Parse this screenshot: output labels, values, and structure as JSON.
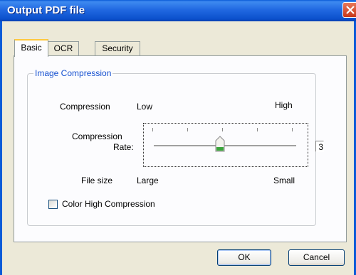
{
  "window": {
    "title": "Output PDF file"
  },
  "tabs": [
    {
      "label": "Basic",
      "active": true
    },
    {
      "label": "OCR",
      "active": false
    },
    {
      "label": "Security",
      "active": false
    }
  ],
  "group": {
    "title": "Image Compression",
    "compression_label": "Compression",
    "compression_low": "Low",
    "compression_high": "High",
    "rate_label_line1": "Compression",
    "rate_label_line2": "Rate:",
    "rate_value": "3",
    "filesize_label": "File size",
    "filesize_large": "Large",
    "filesize_small": "Small",
    "checkbox_label": "Color High Compression",
    "checkbox_checked": false
  },
  "buttons": {
    "ok": "OK",
    "cancel": "Cancel"
  },
  "colors": {
    "titlebar": "#2169E2",
    "group_title": "#1550D0",
    "tab_highlight": "#FFC83C",
    "slider_thumb": "#3BA53B"
  },
  "icons": {
    "close": "close-icon",
    "slider_thumb": "slider-thumb-icon"
  }
}
